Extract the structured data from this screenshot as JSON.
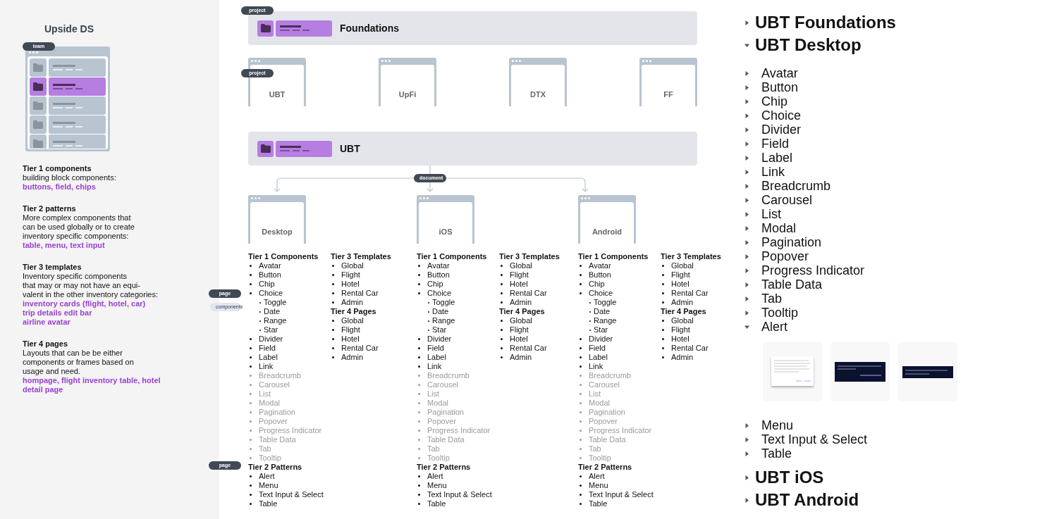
{
  "left": {
    "title": "Upside DS",
    "team_card": {
      "badge": "team",
      "rows": [
        {
          "selected": false
        },
        {
          "selected": true
        },
        {
          "selected": false
        },
        {
          "selected": false
        },
        {
          "selected": false
        }
      ]
    },
    "tiers": [
      {
        "title": "Tier 1 components",
        "description": "building block components:",
        "examples": "buttons, field, chips"
      },
      {
        "title": "Tier 2 patterns",
        "description": "More complex components that\ncan be used globally or to create\ninventory specific components:",
        "examples": "table, menu, text input"
      },
      {
        "title": "Tier 3 templates",
        "description": "Inventory specific components\nthat may or may not have an equi-\nvalent in the other inventory categories:",
        "examples": "inventory cards (flight, hotel, car)\ntrip details edit bar\nairline avatar"
      },
      {
        "title": "Tier 4 pages",
        "description": "Layouts that can be be either\ncomponents or frames based on\nusage and need.",
        "examples": "hompage, flight inventory table, hotel\ndetail page"
      }
    ]
  },
  "foundations": {
    "badge": "project",
    "title": "Foundations"
  },
  "projects": {
    "badge": "project",
    "items": [
      "UBT",
      "UpFi",
      "DTX",
      "FF"
    ]
  },
  "ubt": {
    "title": "UBT"
  },
  "connector": {
    "badge": "document"
  },
  "gutter_badges": [
    {
      "label": "page",
      "kind": "dark"
    },
    {
      "label": "components",
      "kind": "light"
    },
    {
      "label": "page",
      "kind": "dark"
    }
  ],
  "documents": [
    {
      "name": "Desktop",
      "columns": [
        [
          {
            "title": "Tier 1 Components",
            "items": [
              {
                "label": "Avatar",
                "done": true
              },
              {
                "label": "Button",
                "done": true
              },
              {
                "label": "Chip",
                "done": true
              },
              {
                "label": "Choice",
                "done": true,
                "children": [
                  {
                    "label": "Toggle",
                    "done": true
                  },
                  {
                    "label": "Date",
                    "done": true
                  },
                  {
                    "label": "Range",
                    "done": true
                  },
                  {
                    "label": "Star",
                    "done": true
                  }
                ]
              },
              {
                "label": "Divider",
                "done": true
              },
              {
                "label": "Field",
                "done": true
              },
              {
                "label": "Label",
                "done": true
              },
              {
                "label": "Link",
                "done": true
              },
              {
                "label": "Breadcrumb",
                "done": false
              },
              {
                "label": "Carousel",
                "done": false
              },
              {
                "label": "List",
                "done": false
              },
              {
                "label": "Modal",
                "done": false
              },
              {
                "label": "Pagination",
                "done": false
              },
              {
                "label": "Popover",
                "done": false
              },
              {
                "label": "Progress Indicator",
                "done": false
              },
              {
                "label": "Table Data",
                "done": false
              },
              {
                "label": "Tab",
                "done": false
              },
              {
                "label": "Tooltip",
                "done": false
              }
            ]
          },
          {
            "title": "Tier 2 Patterns",
            "items": [
              {
                "label": "Alert",
                "done": true
              },
              {
                "label": "Menu",
                "done": true
              },
              {
                "label": "Text Input & Select",
                "done": true
              },
              {
                "label": "Table",
                "done": true
              }
            ]
          }
        ],
        [
          {
            "title": "Tier 3 Templates",
            "items": [
              {
                "label": "Global",
                "done": true
              },
              {
                "label": "Flight",
                "done": true
              },
              {
                "label": "Hotel",
                "done": true
              },
              {
                "label": "Rental Car",
                "done": true
              },
              {
                "label": "Admin",
                "done": true
              }
            ]
          },
          {
            "title": "Tier 4 Pages",
            "items": [
              {
                "label": "Global",
                "done": true
              },
              {
                "label": "Flight",
                "done": true
              },
              {
                "label": "Hotel",
                "done": true
              },
              {
                "label": "Rental Car",
                "done": true
              },
              {
                "label": "Admin",
                "done": true
              }
            ]
          }
        ]
      ]
    },
    {
      "name": "iOS",
      "columns": [
        [
          {
            "title": "Tier 1 Components",
            "items": [
              {
                "label": "Avatar",
                "done": true
              },
              {
                "label": "Button",
                "done": true
              },
              {
                "label": "Chip",
                "done": true
              },
              {
                "label": "Choice",
                "done": true,
                "children": [
                  {
                    "label": "Toggle",
                    "done": true
                  },
                  {
                    "label": "Date",
                    "done": true
                  },
                  {
                    "label": "Range",
                    "done": true
                  },
                  {
                    "label": "Star",
                    "done": true
                  }
                ]
              },
              {
                "label": "Divider",
                "done": true
              },
              {
                "label": "Field",
                "done": true
              },
              {
                "label": "Label",
                "done": true
              },
              {
                "label": "Link",
                "done": true
              },
              {
                "label": "Breadcrumb",
                "done": false
              },
              {
                "label": "Carousel",
                "done": false
              },
              {
                "label": "List",
                "done": false
              },
              {
                "label": "Modal",
                "done": false
              },
              {
                "label": "Pagination",
                "done": false
              },
              {
                "label": "Popover",
                "done": false
              },
              {
                "label": "Progress Indicator",
                "done": false
              },
              {
                "label": "Table Data",
                "done": false
              },
              {
                "label": "Tab",
                "done": false
              },
              {
                "label": "Tooltip",
                "done": false
              }
            ]
          },
          {
            "title": "Tier 2 Patterns",
            "items": [
              {
                "label": "Alert",
                "done": true
              },
              {
                "label": "Menu",
                "done": true
              },
              {
                "label": "Text Input & Select",
                "done": true
              },
              {
                "label": "Table",
                "done": true
              }
            ]
          }
        ],
        [
          {
            "title": "Tier 3 Templates",
            "items": [
              {
                "label": "Global",
                "done": true
              },
              {
                "label": "Flight",
                "done": true
              },
              {
                "label": "Hotel",
                "done": true
              },
              {
                "label": "Rental Car",
                "done": true
              },
              {
                "label": "Admin",
                "done": true
              }
            ]
          },
          {
            "title": "Tier 4 Pages",
            "items": [
              {
                "label": "Global",
                "done": true
              },
              {
                "label": "Flight",
                "done": true
              },
              {
                "label": "Hotel",
                "done": true
              },
              {
                "label": "Rental Car",
                "done": true
              },
              {
                "label": "Admin",
                "done": true
              }
            ]
          }
        ]
      ]
    },
    {
      "name": "Android",
      "columns": [
        [
          {
            "title": "Tier 1 Components",
            "items": [
              {
                "label": "Avatar",
                "done": true
              },
              {
                "label": "Button",
                "done": true
              },
              {
                "label": "Chip",
                "done": true
              },
              {
                "label": "Choice",
                "done": true,
                "children": [
                  {
                    "label": "Toggle",
                    "done": true
                  },
                  {
                    "label": "Date",
                    "done": true
                  },
                  {
                    "label": "Range",
                    "done": true
                  },
                  {
                    "label": "Star",
                    "done": true
                  }
                ]
              },
              {
                "label": "Divider",
                "done": true
              },
              {
                "label": "Field",
                "done": true
              },
              {
                "label": "Label",
                "done": true
              },
              {
                "label": "Link",
                "done": true
              },
              {
                "label": "Breadcrumb",
                "done": false
              },
              {
                "label": "Carousel",
                "done": false
              },
              {
                "label": "List",
                "done": false
              },
              {
                "label": "Modal",
                "done": false
              },
              {
                "label": "Pagination",
                "done": false
              },
              {
                "label": "Popover",
                "done": false
              },
              {
                "label": "Progress Indicator",
                "done": false
              },
              {
                "label": "Table Data",
                "done": false
              },
              {
                "label": "Tab",
                "done": false
              },
              {
                "label": "Tooltip",
                "done": false
              }
            ]
          },
          {
            "title": "Tier 2 Patterns",
            "items": [
              {
                "label": "Alert",
                "done": true
              },
              {
                "label": "Menu",
                "done": true
              },
              {
                "label": "Text Input & Select",
                "done": true
              },
              {
                "label": "Table",
                "done": true
              }
            ]
          }
        ],
        [
          {
            "title": "Tier 3 Templates",
            "items": [
              {
                "label": "Global",
                "done": true
              },
              {
                "label": "Flight",
                "done": true
              },
              {
                "label": "Hotel",
                "done": true
              },
              {
                "label": "Rental Car",
                "done": true
              },
              {
                "label": "Admin",
                "done": true
              }
            ]
          },
          {
            "title": "Tier 4 Pages",
            "items": [
              {
                "label": "Global",
                "done": true
              },
              {
                "label": "Flight",
                "done": true
              },
              {
                "label": "Hotel",
                "done": true
              },
              {
                "label": "Rental Car",
                "done": true
              },
              {
                "label": "Admin",
                "done": true
              }
            ]
          }
        ]
      ]
    }
  ],
  "tree": [
    {
      "label": "UBT Foundations",
      "expanded": false
    },
    {
      "label": "UBT Desktop",
      "expanded": true,
      "children": [
        {
          "label": "Avatar",
          "expanded": false
        },
        {
          "label": "Button",
          "expanded": false
        },
        {
          "label": "Chip",
          "expanded": false
        },
        {
          "label": "Choice",
          "expanded": false
        },
        {
          "label": "Divider",
          "expanded": false
        },
        {
          "label": "Field",
          "expanded": false
        },
        {
          "label": "Label",
          "expanded": false
        },
        {
          "label": "Link",
          "expanded": false
        },
        {
          "label": "Breadcrumb",
          "expanded": false
        },
        {
          "label": "Carousel",
          "expanded": false
        },
        {
          "label": "List",
          "expanded": false
        },
        {
          "label": "Modal",
          "expanded": false
        },
        {
          "label": "Pagination",
          "expanded": false
        },
        {
          "label": "Popover",
          "expanded": false
        },
        {
          "label": "Progress Indicator",
          "expanded": false
        },
        {
          "label": "Table Data",
          "expanded": false
        },
        {
          "label": "Tab",
          "expanded": false
        },
        {
          "label": "Tooltip",
          "expanded": false
        },
        {
          "label": "Alert",
          "expanded": true,
          "previews": [
            {
              "kind": "dialog"
            },
            {
              "kind": "snackbar-action"
            },
            {
              "kind": "snackbar"
            }
          ]
        },
        {
          "label": "Menu",
          "expanded": false
        },
        {
          "label": "Text Input & Select",
          "expanded": false
        },
        {
          "label": "Table",
          "expanded": false
        }
      ]
    },
    {
      "label": "UBT iOS",
      "expanded": false
    },
    {
      "label": "UBT Android",
      "expanded": false
    }
  ]
}
